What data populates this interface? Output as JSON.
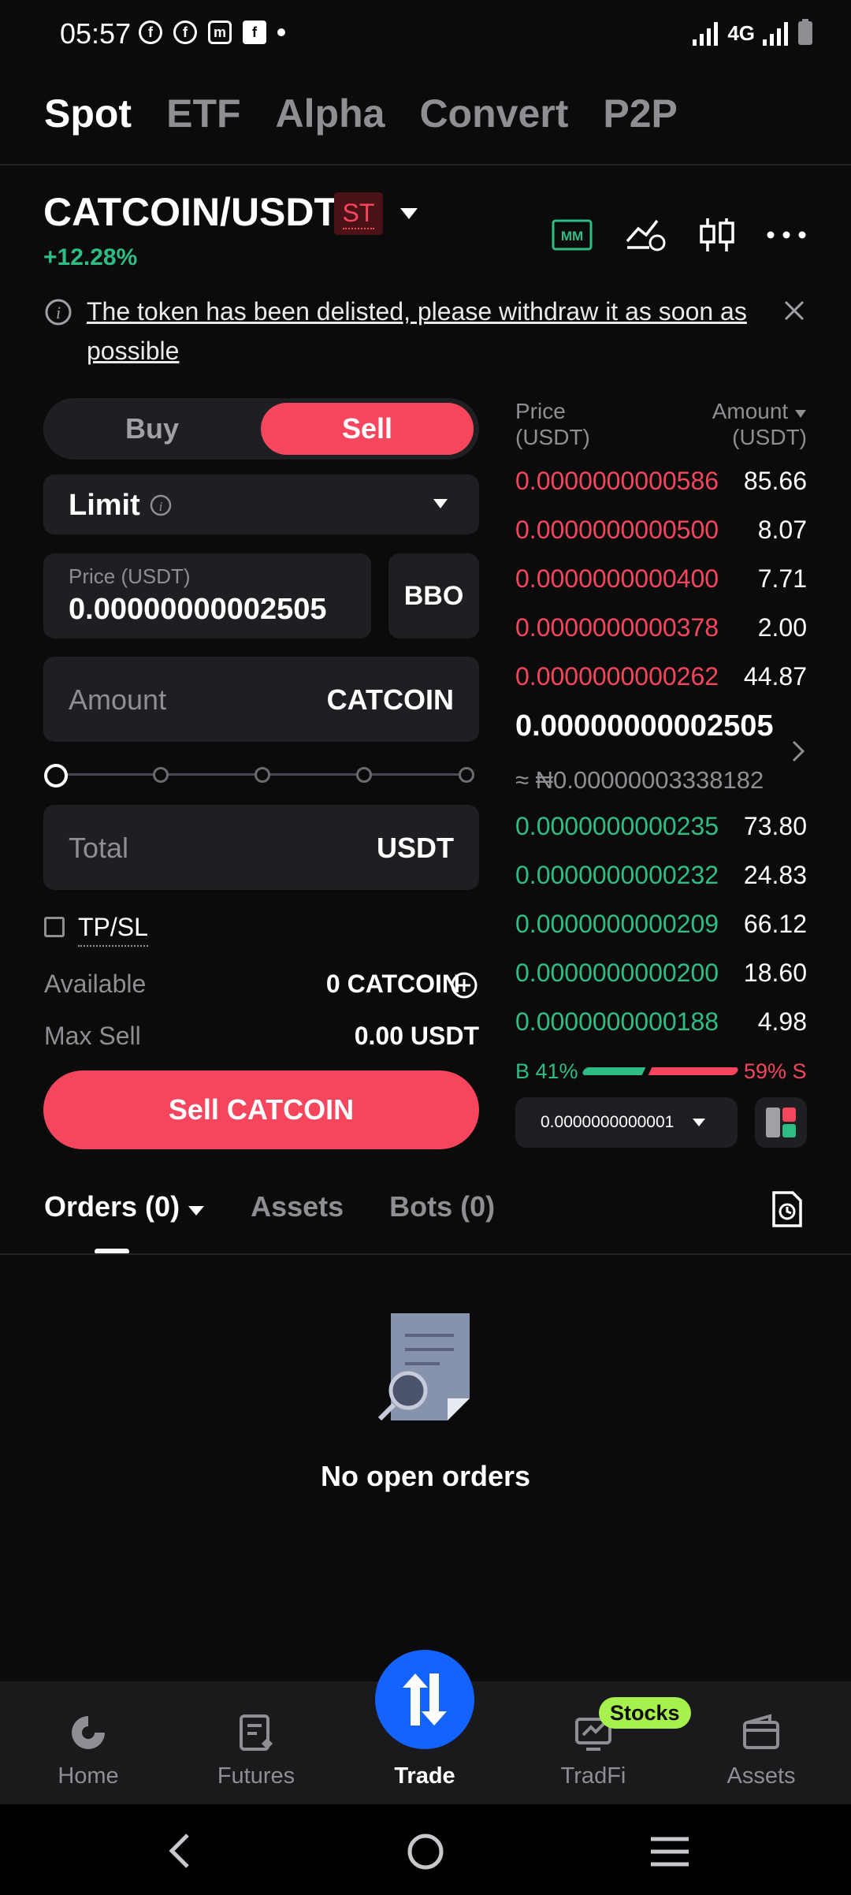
{
  "status": {
    "time": "05:57",
    "network": "4G"
  },
  "top_tabs": [
    "Spot",
    "ETF",
    "Alpha",
    "Convert",
    "P2P"
  ],
  "pair": {
    "name": "CATCOIN/USDT",
    "badge": "ST",
    "change": "+12.28%"
  },
  "notice": {
    "text": "The token has been delisted, please withdraw it as soon as possible"
  },
  "order_form": {
    "buy_label": "Buy",
    "sell_label": "Sell",
    "order_type": "Limit",
    "price_label": "Price (USDT)",
    "price_value": "0.00000000002505",
    "bbo_label": "BBO",
    "amount_placeholder": "Amount",
    "amount_unit": "CATCOIN",
    "total_placeholder": "Total",
    "total_unit": "USDT",
    "tpsl_label": "TP/SL",
    "available_label": "Available",
    "available_value": "0 CATCOIN",
    "maxsell_label": "Max Sell",
    "maxsell_value": "0.00 USDT",
    "submit_label": "Sell CATCOIN"
  },
  "orderbook": {
    "price_header": "Price",
    "price_unit": "(USDT)",
    "amount_header": "Amount",
    "amount_unit": "(USDT)",
    "asks": [
      {
        "price": "0.0000000000586",
        "amount": "85.66"
      },
      {
        "price": "0.0000000000500",
        "amount": "8.07"
      },
      {
        "price": "0.0000000000400",
        "amount": "7.71"
      },
      {
        "price": "0.0000000000378",
        "amount": "2.00"
      },
      {
        "price": "0.0000000000262",
        "amount": "44.87"
      }
    ],
    "last_price": "0.00000000002505",
    "last_price_fiat": "≈ ₦0.00000003338182",
    "bids": [
      {
        "price": "0.0000000000235",
        "amount": "73.80"
      },
      {
        "price": "0.0000000000232",
        "amount": "24.83"
      },
      {
        "price": "0.0000000000209",
        "amount": "66.12"
      },
      {
        "price": "0.0000000000200",
        "amount": "18.60"
      },
      {
        "price": "0.0000000000188",
        "amount": "4.98"
      }
    ],
    "buy_ratio": "B 41%",
    "sell_ratio": "59% S",
    "buy_fraction": 0.41,
    "precision": "0.0000000000001"
  },
  "orders_tabs": [
    "Orders (0)",
    "Assets",
    "Bots (0)"
  ],
  "empty_state": "No open orders",
  "bottom_nav": {
    "home": "Home",
    "futures": "Futures",
    "trade": "Trade",
    "tradfi": "TradFi",
    "tradfi_badge": "Stocks",
    "assets": "Assets"
  },
  "colors": {
    "sell": "#f6465d",
    "buy": "#2ebd85",
    "trade": "#1463ff"
  }
}
